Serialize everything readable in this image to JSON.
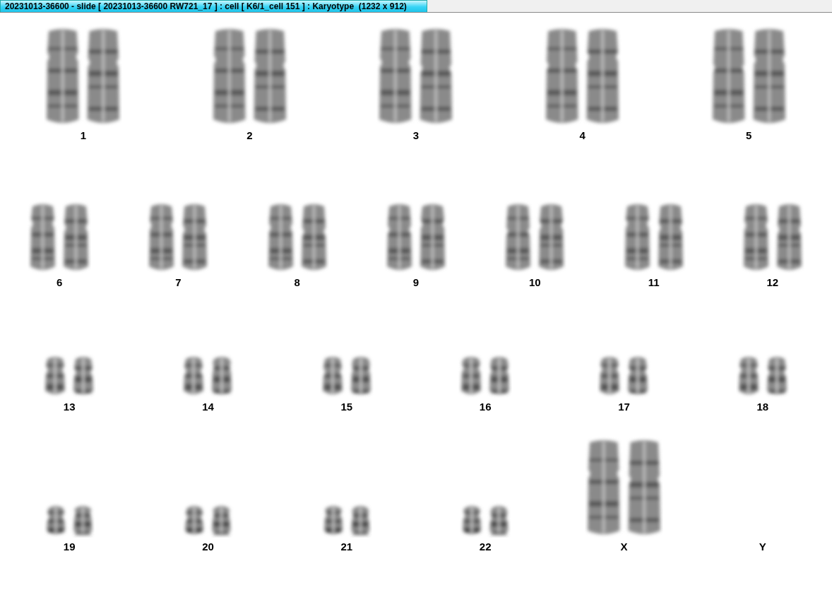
{
  "window": {
    "title": "20231013-36600 - slide [ 20231013-36600 RW721_17 ] : cell [ K6/1_cell 151 ] : Karyotype  (1232 x 912)"
  },
  "karyotype": {
    "rows": [
      {
        "items": [
          {
            "label": "1",
            "kind": "large"
          },
          {
            "label": "2",
            "kind": "large"
          },
          {
            "label": "3",
            "kind": "large"
          },
          {
            "label": "4",
            "kind": "large"
          },
          {
            "label": "5",
            "kind": "large"
          }
        ]
      },
      {
        "items": [
          {
            "label": "6",
            "kind": "medium"
          },
          {
            "label": "7",
            "kind": "medium"
          },
          {
            "label": "8",
            "kind": "medium"
          },
          {
            "label": "9",
            "kind": "medium"
          },
          {
            "label": "10",
            "kind": "medium"
          },
          {
            "label": "11",
            "kind": "medium"
          },
          {
            "label": "12",
            "kind": "medium"
          }
        ]
      },
      {
        "items": [
          {
            "label": "13",
            "kind": "small"
          },
          {
            "label": "14",
            "kind": "small"
          },
          {
            "label": "15",
            "kind": "small"
          },
          {
            "label": "16",
            "kind": "small"
          },
          {
            "label": "17",
            "kind": "small"
          },
          {
            "label": "18",
            "kind": "small"
          }
        ]
      },
      {
        "items": [
          {
            "label": "19",
            "kind": "tiny"
          },
          {
            "label": "20",
            "kind": "tiny"
          },
          {
            "label": "21",
            "kind": "tiny"
          },
          {
            "label": "22",
            "kind": "tiny"
          },
          {
            "label": "X",
            "kind": "large"
          },
          {
            "label": "Y",
            "kind": "empty"
          }
        ]
      }
    ]
  }
}
